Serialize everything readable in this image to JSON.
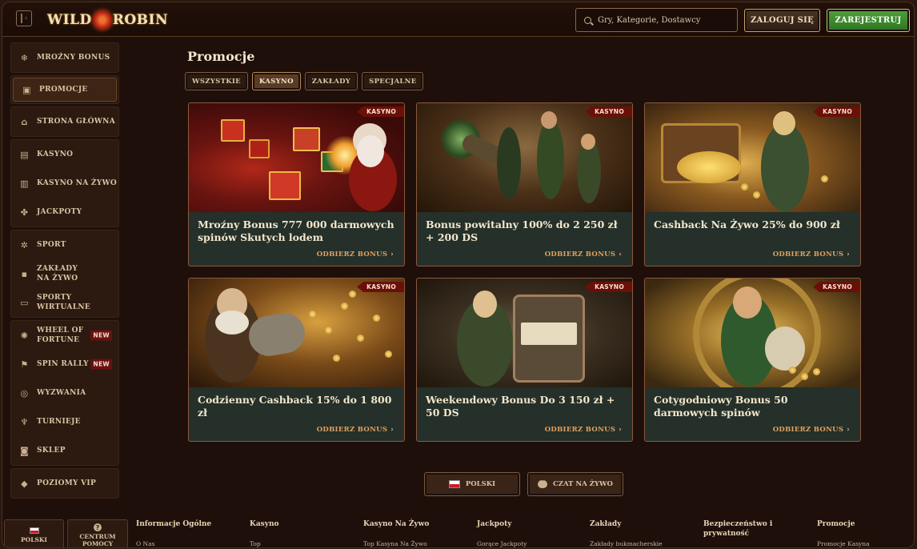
{
  "header": {
    "logo_text_left": "WILD",
    "logo_text_right": "ROBIN",
    "search_placeholder": "Gry, Kategorie, Dostawcy",
    "login_label": "ZALOGUJ SIĘ",
    "register_label": "ZAREJESTRUJ",
    "register_color": "#3d8a2c"
  },
  "sidebar": {
    "groups": [
      [
        {
          "label": "MROŹNY BONUS",
          "icon": "snowflake-icon"
        }
      ],
      [
        {
          "label": "PROMOCJE",
          "icon": "gift-icon",
          "active": true
        }
      ],
      [
        {
          "label": "STRONA GŁÓWNA",
          "icon": "home-icon"
        }
      ],
      [
        {
          "label": "KASYNO",
          "icon": "slot-machine-icon"
        },
        {
          "label": "KASYNO NA ŻYWO",
          "icon": "cards-icon"
        },
        {
          "label": "JACKPOTY",
          "icon": "clover-icon"
        }
      ],
      [
        {
          "label": "SPORT",
          "icon": "soccer-ball-icon"
        },
        {
          "label": "ZAKŁADY NA ŻYWO",
          "icon": "live-icon"
        },
        {
          "label": "SPORTY WIRTUALNE",
          "icon": "monitor-icon"
        }
      ],
      [
        {
          "label": "WHEEL OF FORTUNE",
          "icon": "wheel-icon",
          "badge": "NEW"
        },
        {
          "label": "SPIN RALLY",
          "icon": "flag-icon",
          "badge": "NEW"
        },
        {
          "label": "WYZWANIA",
          "icon": "target-icon"
        },
        {
          "label": "TURNIEJE",
          "icon": "trophy-icon"
        },
        {
          "label": "SKLEP",
          "icon": "shopping-bag-icon"
        }
      ],
      [
        {
          "label": "POZIOMY VIP",
          "icon": "diamond-icon"
        }
      ]
    ]
  },
  "main": {
    "title": "Promocje",
    "tabs": [
      {
        "label": "WSZYSTKIE",
        "active": false
      },
      {
        "label": "KASYNO",
        "active": true
      },
      {
        "label": "ZAKŁADY",
        "active": false
      },
      {
        "label": "SPECJALNE",
        "active": false
      }
    ],
    "cards": [
      {
        "tag": "KASYNO",
        "title": "Mroźny Bonus 777 000 darmowych spinów Skutych lodem",
        "cta": "ODBIERZ BONUS"
      },
      {
        "tag": "KASYNO",
        "title": "Bonus powitalny 100% do 2 250 zł + 200 DS",
        "cta": "ODBIERZ BONUS"
      },
      {
        "tag": "KASYNO",
        "title": "Cashback Na Żywo 25% do 900 zł",
        "cta": "ODBIERZ BONUS"
      },
      {
        "tag": "KASYNO",
        "title": "Codzienny Cashback 15% do 1 800 zł",
        "cta": "ODBIERZ BONUS"
      },
      {
        "tag": "KASYNO",
        "title": "Weekendowy Bonus Do 3 150 zł + 50 DS",
        "cta": "ODBIERZ BONUS"
      },
      {
        "tag": "KASYNO",
        "title": "Cotygodniowy Bonus 50 darmowych spinów",
        "cta": "ODBIERZ BONUS"
      }
    ],
    "language_button": "POLSKI",
    "chat_button": "CZAT NA ŻYWO"
  },
  "footer": {
    "language": "POLSKI",
    "help": "CENTRUM POMOCY",
    "columns": [
      {
        "heading": "Informacje Ogólne",
        "link": "O Nas"
      },
      {
        "heading": "Kasyno",
        "link": "Top"
      },
      {
        "heading": "Kasyno Na Żywo",
        "link": "Top Kasyna Na Żywo"
      },
      {
        "heading": "Jackpoty",
        "link": "Gorące Jackpoty"
      },
      {
        "heading": "Zakłady",
        "link": "Zakłady bukmacherskie"
      },
      {
        "heading": "Bezpieczeństwo i prywatność",
        "link": ""
      },
      {
        "heading": "Promocje",
        "link": "Promocje Kasyna"
      }
    ]
  },
  "colors": {
    "background": "#1e0f0a",
    "card": "#243029",
    "badge": "#6a1008",
    "cta": "#e0a060"
  }
}
